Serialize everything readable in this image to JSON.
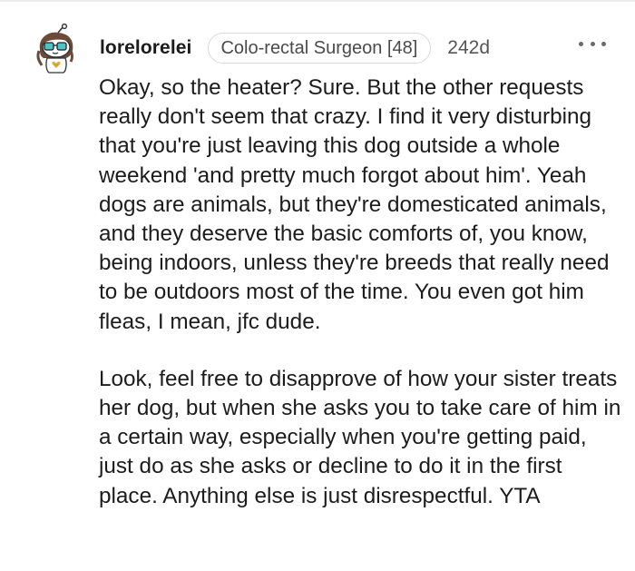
{
  "comment": {
    "username": "lorelorelei",
    "flair": "Colo-rectal Surgeon [48]",
    "age": "242d",
    "more_glyph": "more-options-icon",
    "paragraphs": [
      "Okay, so the heater? Sure. But the other requests really don't seem that crazy. I find it very disturbing that you're just leaving this dog outside a whole weekend 'and pretty much forgot about him'. Yeah dogs are animals, but they're domesticated animals, and they deserve the basic comforts of, you know, being indoors, unless they're breeds that really need to be outdoors most of the time. You even got him fleas, I mean, jfc dude.",
      "Look, feel free to disapprove of how your sister treats her dog, but when she asks you to take care of him in a certain way, especially when you're getting paid, just do as she asks or decline to do it in the first place. Anything else is just disrespectful. YTA"
    ]
  },
  "colors": {
    "text": "#1c1c1c",
    "muted": "#555555",
    "flair_border": "#d9d9d9",
    "avatar_hair": "#6b4a3a",
    "avatar_glasses": "#4fc3c8"
  }
}
